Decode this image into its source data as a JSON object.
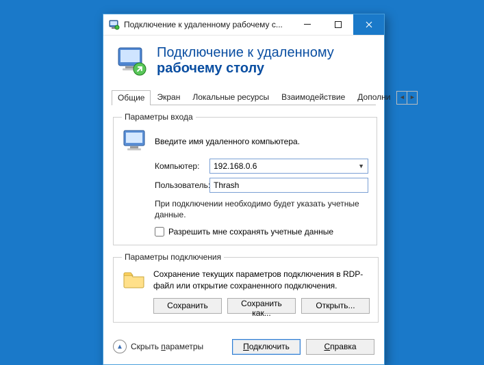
{
  "titlebar": {
    "text": "Подключение к удаленному рабочему с..."
  },
  "header": {
    "line1": "Подключение к удаленному",
    "line2": "рабочему столу"
  },
  "tabs": {
    "items": [
      "Общие",
      "Экран",
      "Локальные ресурсы",
      "Взаимодействие",
      "Дополни"
    ],
    "active": 0
  },
  "login_group": {
    "legend": "Параметры входа",
    "intro": "Введите имя удаленного компьютера.",
    "computer_label": "Компьютер:",
    "computer_value": "192.168.0.6",
    "user_label": "Пользователь:",
    "user_value": "Thrash",
    "note": "При подключении необходимо будет указать учетные данные.",
    "checkbox_label": "Разрешить мне сохранять учетные данные"
  },
  "conn_group": {
    "legend": "Параметры подключения",
    "text": "Сохранение текущих параметров подключения в RDP-файл или открытие сохраненного подключения.",
    "save": "Сохранить",
    "save_as": "Сохранить как...",
    "open": "Открыть..."
  },
  "footer": {
    "hide": "Скрыть параметры",
    "hide_u_index": 7,
    "connect": "Подключить",
    "connect_u_index": 0,
    "help": "Справка",
    "help_u_index": 0
  }
}
